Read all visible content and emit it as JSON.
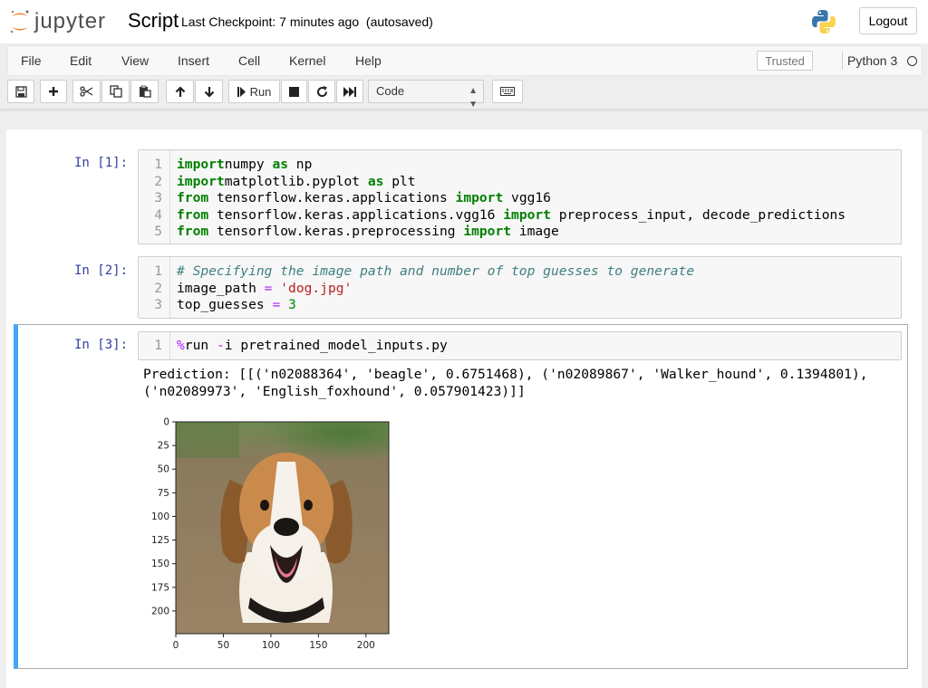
{
  "header": {
    "logo_text": "jupyter",
    "notebook_title": "Script",
    "checkpoint": "Last Checkpoint: 7 minutes ago",
    "autosave": "(autosaved)",
    "logout_label": "Logout",
    "python_logo": "python-logo-icon"
  },
  "menubar": {
    "items": [
      "File",
      "Edit",
      "View",
      "Insert",
      "Cell",
      "Kernel",
      "Help"
    ],
    "trusted_label": "Trusted",
    "kernel_name": "Python 3"
  },
  "toolbar": {
    "buttons": [
      "save-icon",
      "plus-icon",
      "cut-icon",
      "copy-icon",
      "paste-icon",
      "arrow-up-icon",
      "arrow-down-icon",
      "run-icon",
      "stop-icon",
      "restart-icon",
      "fast-forward-icon",
      "keyboard-icon"
    ],
    "run_label": "Run",
    "cell_type": "Code"
  },
  "cells": [
    {
      "prompt": "In [1]:",
      "line_numbers": [
        "1",
        "2",
        "3",
        "4",
        "5"
      ],
      "lines": [
        [
          [
            "kw",
            "import"
          ],
          [
            "",
            "numpy "
          ],
          [
            "kw",
            "as"
          ],
          [
            "",
            " np"
          ]
        ],
        [
          [
            "kw",
            "import"
          ],
          [
            "",
            "matplotlib.pyplot "
          ],
          [
            "kw",
            "as"
          ],
          [
            "",
            " plt"
          ]
        ],
        [
          [
            "kw",
            "from"
          ],
          [
            "",
            " tensorflow.keras.applications "
          ],
          [
            "kw",
            "import"
          ],
          [
            "",
            " vgg16"
          ]
        ],
        [
          [
            "kw",
            "from"
          ],
          [
            "",
            " tensorflow.keras.applications.vgg16 "
          ],
          [
            "kw",
            "import"
          ],
          [
            "",
            " preprocess_input, decode_predictions"
          ]
        ],
        [
          [
            "kw",
            "from"
          ],
          [
            "",
            " tensorflow.keras.preprocessing "
          ],
          [
            "kw",
            "import"
          ],
          [
            "",
            " image"
          ]
        ]
      ]
    },
    {
      "prompt": "In [2]:",
      "line_numbers": [
        "1",
        "2",
        "3"
      ],
      "lines": [
        [
          [
            "cmt",
            "# Specifying the image path and number of top guesses to generate"
          ]
        ],
        [
          [
            "",
            "image_path "
          ],
          [
            "op",
            "="
          ],
          [
            "",
            " "
          ],
          [
            "str",
            "'dog.jpg'"
          ]
        ],
        [
          [
            "",
            "top_guesses "
          ],
          [
            "op",
            "="
          ],
          [
            "",
            " "
          ],
          [
            "num",
            "3"
          ]
        ]
      ]
    },
    {
      "prompt": "In [3]:",
      "line_numbers": [
        "1"
      ],
      "lines": [
        [
          [
            "op",
            "%"
          ],
          [
            "",
            "run "
          ],
          [
            "op",
            "-"
          ],
          [
            "",
            "i pretrained_model_inputs.py"
          ]
        ]
      ],
      "output_lines": [
        "Prediction: [[('n02088364', 'beagle', 0.6751468), ('n02089867', 'Walker_hound', 0.1394801),",
        "('n02089973', 'English_foxhound', 0.057901423)]]"
      ]
    }
  ],
  "plot": {
    "image_description_icon": "beagle-photo-icon",
    "yticks": [
      "0",
      "25",
      "50",
      "75",
      "100",
      "125",
      "150",
      "175",
      "200"
    ],
    "xticks": [
      "0",
      "50",
      "100",
      "150",
      "200"
    ]
  }
}
